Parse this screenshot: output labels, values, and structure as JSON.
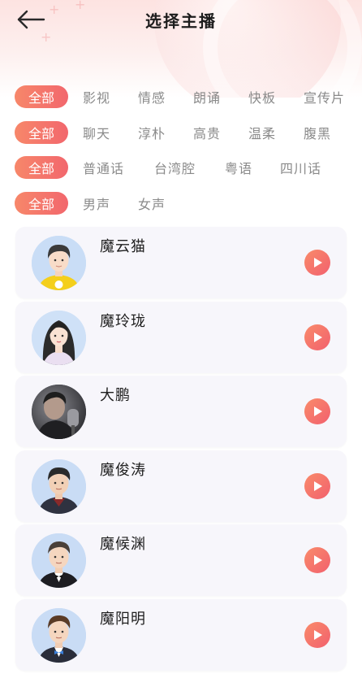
{
  "header": {
    "title": "选择主播"
  },
  "filters": [
    {
      "all_label": "全部",
      "options": [
        "影视",
        "情感",
        "朗诵",
        "快板",
        "宣传片"
      ]
    },
    {
      "all_label": "全部",
      "options": [
        "聊天",
        "淳朴",
        "高贵",
        "温柔",
        "腹黑"
      ]
    },
    {
      "all_label": "全部",
      "options": [
        "普通话",
        "台湾腔",
        "粤语",
        "四川话"
      ]
    },
    {
      "all_label": "全部",
      "options": [
        "男声",
        "女声"
      ]
    }
  ],
  "anchors": [
    {
      "name": "魔云猫",
      "avatar": "avatar-young-man-yellow-shirt"
    },
    {
      "name": "魔玲珑",
      "avatar": "avatar-woman-long-hair"
    },
    {
      "name": "大鹏",
      "avatar": "avatar-photo-singer-microphone"
    },
    {
      "name": "魔俊涛",
      "avatar": "avatar-man-dark-jacket"
    },
    {
      "name": "魔候渊",
      "avatar": "avatar-man-suit-bowtie"
    },
    {
      "name": "魔阳明",
      "avatar": "avatar-man-suit-blue-bowtie"
    }
  ],
  "colors": {
    "accent_start": "#f7876a",
    "accent_end": "#f2676d",
    "card_bg": "#f7f6fb",
    "header_bg": "#fde3e1"
  }
}
